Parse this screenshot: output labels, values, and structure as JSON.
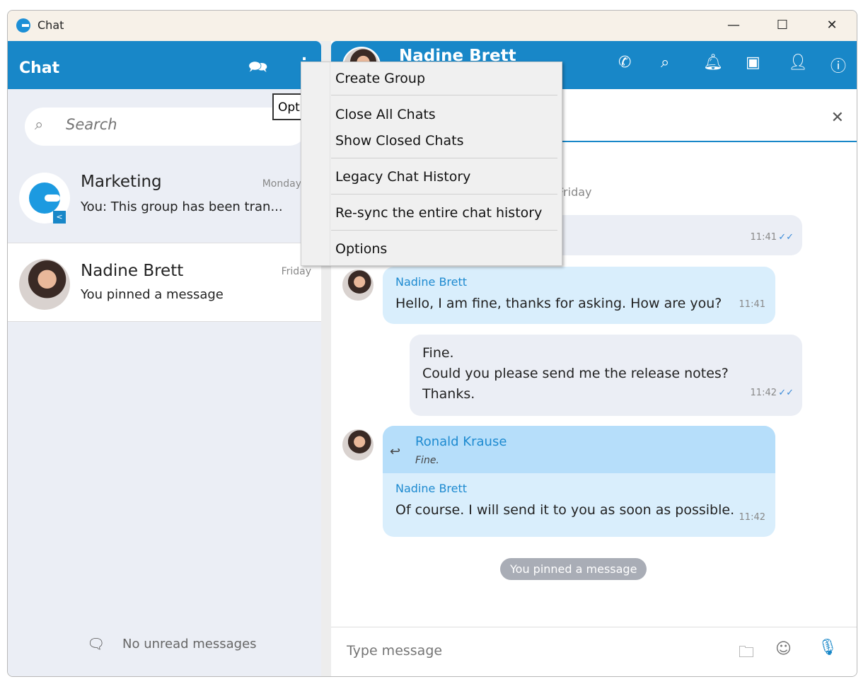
{
  "window": {
    "title": "Chat",
    "minimize": "—",
    "maximize": "☐",
    "close": "✕"
  },
  "left": {
    "title": "Chat",
    "search_placeholder": "Search",
    "tooltip": "Options",
    "conversations": [
      {
        "name": "Marketing",
        "preview": "You: This group has been tran...",
        "date": "Monday"
      },
      {
        "name": "Nadine Brett",
        "preview": "You pinned a message",
        "date": "Friday"
      }
    ],
    "no_unread": "No unread messages"
  },
  "chat": {
    "contact": "Nadine Brett",
    "date_label": "Friday",
    "messages": [
      {
        "dir": "out",
        "text": "",
        "time": "11:41"
      },
      {
        "dir": "in",
        "sender": "Nadine Brett",
        "text": "Hello, I am fine, thanks for asking. How are you?",
        "time": "11:41"
      },
      {
        "dir": "out",
        "lines": [
          "Fine.",
          "Could you please send me the release notes?",
          "Thanks."
        ],
        "time": "11:42"
      },
      {
        "dir": "in",
        "quote_sender": "Ronald Krause",
        "quote_text": "Fine.",
        "sender": "Nadine Brett",
        "text": "Of course. I will send it to you as soon as possible.",
        "time": "11:42"
      }
    ],
    "pinned": "You pinned a message",
    "input_placeholder": "Type message"
  },
  "menu": [
    "Create Group",
    "Close All Chats",
    "Show Closed Chats",
    "Legacy Chat History",
    "Re-sync the entire chat history",
    "Options"
  ],
  "colors": {
    "accent": "#1887c8",
    "incoming": "#d9eefc",
    "outgoing": "#ebeef5"
  }
}
